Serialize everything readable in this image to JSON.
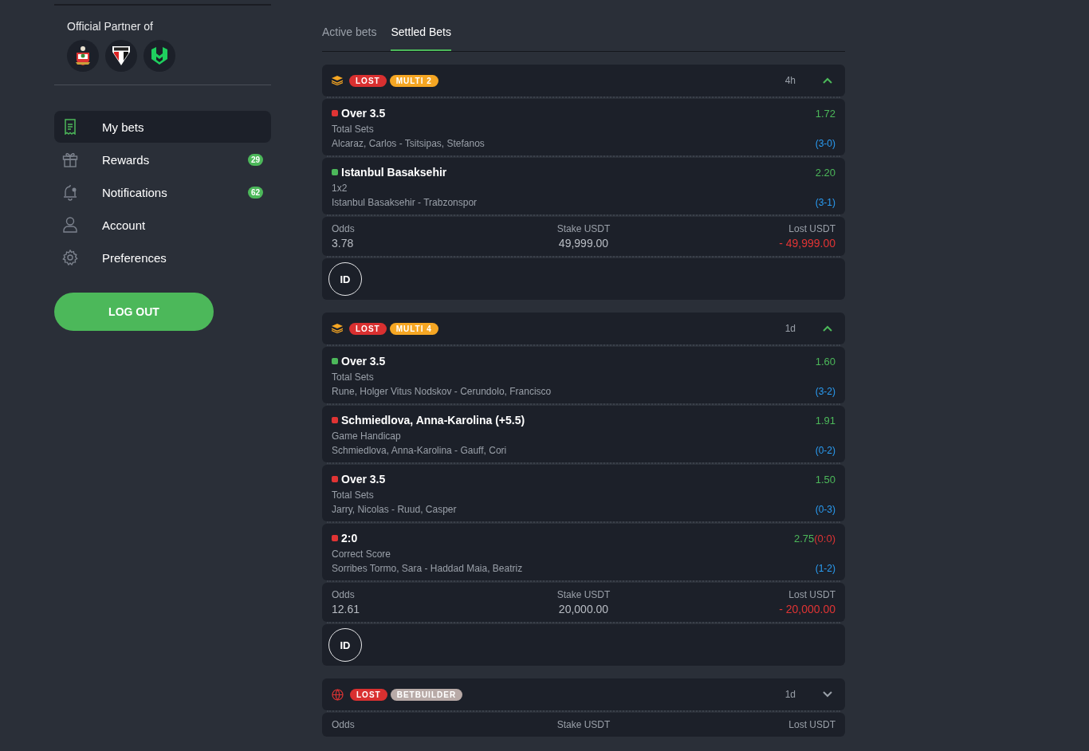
{
  "sidebar": {
    "partner_title": "Official Partner of",
    "menu": [
      {
        "label": "My bets",
        "selected": true
      },
      {
        "label": "Rewards",
        "selected": false,
        "badge": "29"
      },
      {
        "label": "Notifications",
        "selected": false,
        "badge": "62"
      },
      {
        "label": "Account",
        "selected": false
      },
      {
        "label": "Preferences",
        "selected": false
      }
    ],
    "logout": "LOG OUT"
  },
  "tabs": [
    {
      "label": "Active bets",
      "selected": false
    },
    {
      "label": "Settled Bets",
      "selected": true
    }
  ],
  "bets": [
    {
      "kind": "multi",
      "status": "LOST",
      "type_label": "MULTI 2",
      "time": "4h",
      "expanded": true,
      "selections": [
        {
          "color": "#e03434",
          "name": "Over 3.5",
          "odds": "1.72",
          "market": "Total Sets",
          "event": "Alcaraz, Carlos - Tsitsipas, Stefanos",
          "score": "(3-0)"
        },
        {
          "color": "#4cb85a",
          "name": "Istanbul Basaksehir",
          "odds": "2.20",
          "market": "1x2",
          "event": "Istanbul Basaksehir - Trabzonspor",
          "score": "(3-1)"
        }
      ],
      "summary": {
        "odds_label": "Odds",
        "odds": "3.78",
        "stake_label": "Stake USDT",
        "stake": "49,999.00",
        "result_label": "Lost USDT",
        "result": "- 49,999.00"
      },
      "id_button": "ID"
    },
    {
      "kind": "multi",
      "status": "LOST",
      "type_label": "MULTI 4",
      "time": "1d",
      "expanded": true,
      "selections": [
        {
          "color": "#4cb85a",
          "name": "Over 3.5",
          "odds": "1.60",
          "market": "Total Sets",
          "event": "Rune, Holger Vitus Nodskov - Cerundolo, Francisco",
          "score": "(3-2)"
        },
        {
          "color": "#e03434",
          "name": "Schmiedlova, Anna-Karolina (+5.5)",
          "odds": "1.91",
          "market": "Game Handicap",
          "event": "Schmiedlova, Anna-Karolina - Gauff, Cori",
          "score": "(0-2)"
        },
        {
          "color": "#e03434",
          "name": "Over 3.5",
          "odds": "1.50",
          "market": "Total Sets",
          "event": "Jarry, Nicolas - Ruud, Casper",
          "score": "(0-3)"
        },
        {
          "color": "#e03434",
          "name": "2:0",
          "odds": "2.75",
          "live_score": "(0:0)",
          "market": "Correct Score",
          "event": "Sorribes Tormo, Sara - Haddad Maia, Beatriz",
          "score": "(1-2)"
        }
      ],
      "summary": {
        "odds_label": "Odds",
        "odds": "12.61",
        "stake_label": "Stake USDT",
        "stake": "20,000.00",
        "result_label": "Lost USDT",
        "result": "- 20,000.00"
      },
      "id_button": "ID"
    },
    {
      "kind": "betbuilder",
      "status": "LOST",
      "type_label": "BETBUILDER",
      "time": "1d",
      "expanded": false,
      "summary": {
        "odds_label": "Odds",
        "stake_label": "Stake USDT",
        "result_label": "Lost USDT"
      }
    }
  ]
}
